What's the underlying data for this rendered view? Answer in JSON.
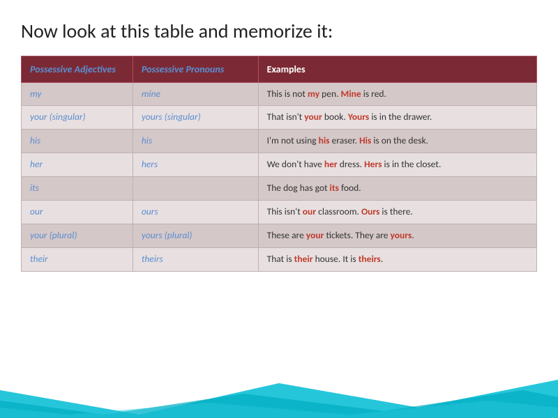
{
  "title": "Now look at this table and memorize it:",
  "table": {
    "headers": [
      "Possessive Adjectives",
      "Possessive Pronouns",
      "Examples"
    ],
    "rows": [
      {
        "adjective": "my",
        "pronoun": "mine",
        "example_parts": [
          {
            "text": "This is not ",
            "type": "normal"
          },
          {
            "text": "my",
            "type": "red"
          },
          {
            "text": " pen. ",
            "type": "normal"
          },
          {
            "text": "Mine",
            "type": "red"
          },
          {
            "text": " is red.",
            "type": "normal"
          }
        ]
      },
      {
        "adjective": "your (singular)",
        "pronoun": "yours (singular)",
        "example_parts": [
          {
            "text": "That isn't ",
            "type": "normal"
          },
          {
            "text": "your",
            "type": "red"
          },
          {
            "text": " book. ",
            "type": "normal"
          },
          {
            "text": "Yours",
            "type": "red"
          },
          {
            "text": " is in the drawer.",
            "type": "normal"
          }
        ]
      },
      {
        "adjective": "his",
        "pronoun": "his",
        "example_parts": [
          {
            "text": "I'm not using ",
            "type": "normal"
          },
          {
            "text": "his",
            "type": "red"
          },
          {
            "text": " eraser. ",
            "type": "normal"
          },
          {
            "text": "His",
            "type": "red"
          },
          {
            "text": " is on the desk.",
            "type": "normal"
          }
        ]
      },
      {
        "adjective": "her",
        "pronoun": "hers",
        "example_parts": [
          {
            "text": "We don't have ",
            "type": "normal"
          },
          {
            "text": "her",
            "type": "red"
          },
          {
            "text": " dress. ",
            "type": "normal"
          },
          {
            "text": "Hers",
            "type": "red"
          },
          {
            "text": " is in the closet.",
            "type": "normal"
          }
        ]
      },
      {
        "adjective": "its",
        "pronoun": "",
        "example_parts": [
          {
            "text": "The dog has got ",
            "type": "normal"
          },
          {
            "text": "its",
            "type": "red"
          },
          {
            "text": " food.",
            "type": "normal"
          }
        ]
      },
      {
        "adjective": "our",
        "pronoun": "ours",
        "example_parts": [
          {
            "text": "This isn't ",
            "type": "normal"
          },
          {
            "text": "our",
            "type": "red"
          },
          {
            "text": " classroom. ",
            "type": "normal"
          },
          {
            "text": "Ours",
            "type": "red"
          },
          {
            "text": " is there.",
            "type": "normal"
          }
        ]
      },
      {
        "adjective": "your (plural)",
        "pronoun": "yours (plural)",
        "example_parts": [
          {
            "text": "These are ",
            "type": "normal"
          },
          {
            "text": "your",
            "type": "red"
          },
          {
            "text": " tickets. They are ",
            "type": "normal"
          },
          {
            "text": "yours",
            "type": "red"
          },
          {
            "text": ".",
            "type": "normal"
          }
        ]
      },
      {
        "adjective": "their",
        "pronoun": "theirs",
        "example_parts": [
          {
            "text": "That is ",
            "type": "normal"
          },
          {
            "text": "their",
            "type": "red"
          },
          {
            "text": " house. It is ",
            "type": "normal"
          },
          {
            "text": "theirs",
            "type": "red"
          },
          {
            "text": ".",
            "type": "normal"
          }
        ]
      }
    ]
  }
}
